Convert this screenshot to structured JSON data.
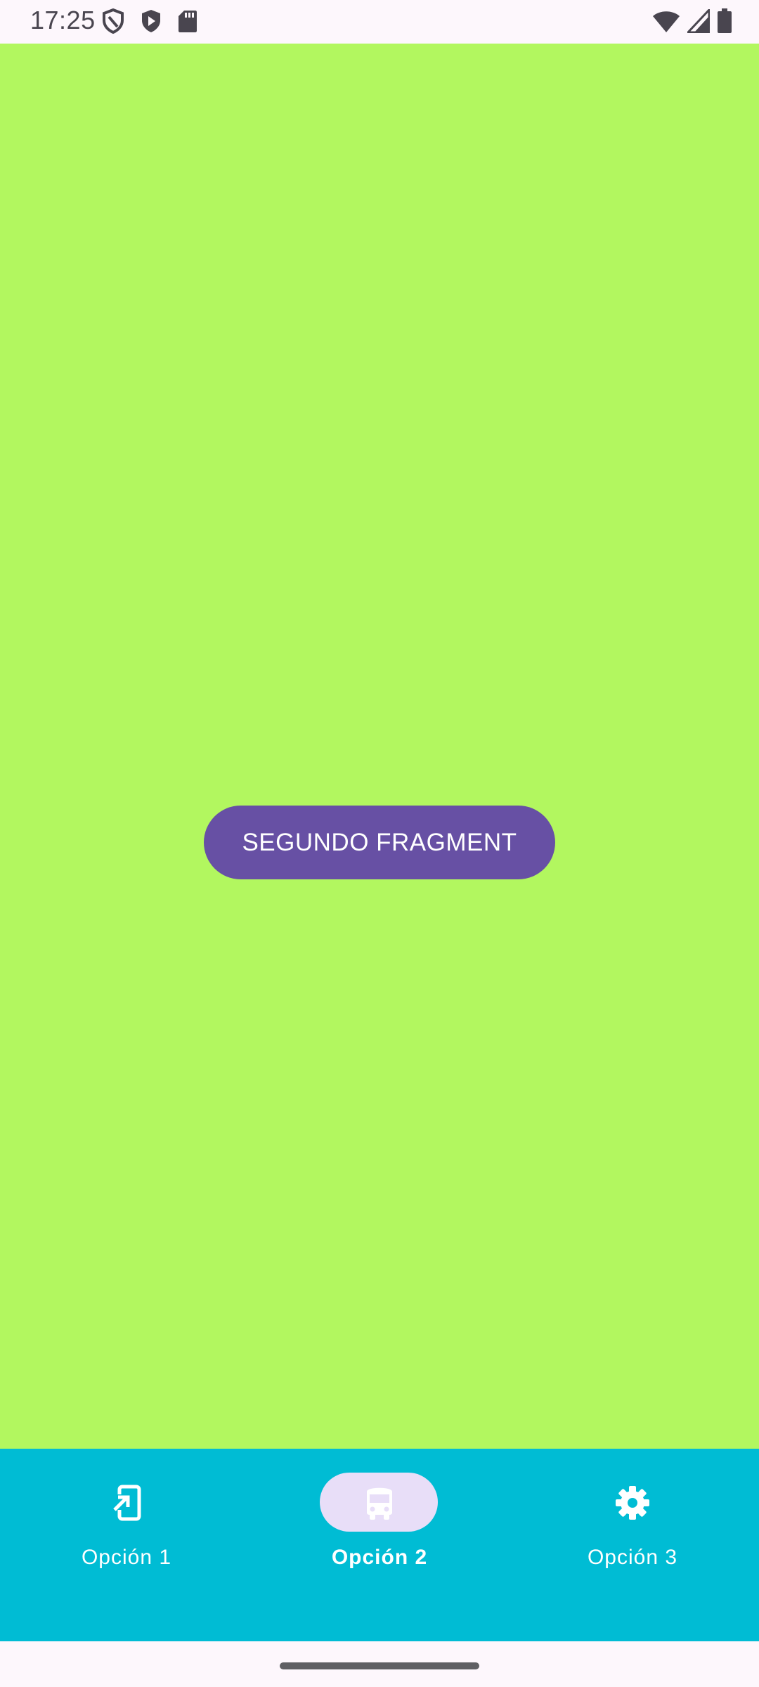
{
  "status_bar": {
    "time": "17:25",
    "left_icons": [
      "shield-outline-icon",
      "play-protect-icon",
      "sd-card-icon"
    ],
    "right_icons": [
      "wifi-icon",
      "cell-signal-icon",
      "battery-icon"
    ]
  },
  "content": {
    "background_color": "#b2f75f",
    "button_label": "SEGUNDO FRAGMENT",
    "button_color": "#6750a4"
  },
  "bottom_nav": {
    "background_color": "#00bcd4",
    "selected_index": 1,
    "items": [
      {
        "label": "Opción 1",
        "icon": "phone-redirect-icon",
        "selected": false
      },
      {
        "label": "Opción 2",
        "icon": "bus-icon",
        "selected": true
      },
      {
        "label": "Opción 3",
        "icon": "gear-icon",
        "selected": false
      }
    ]
  }
}
